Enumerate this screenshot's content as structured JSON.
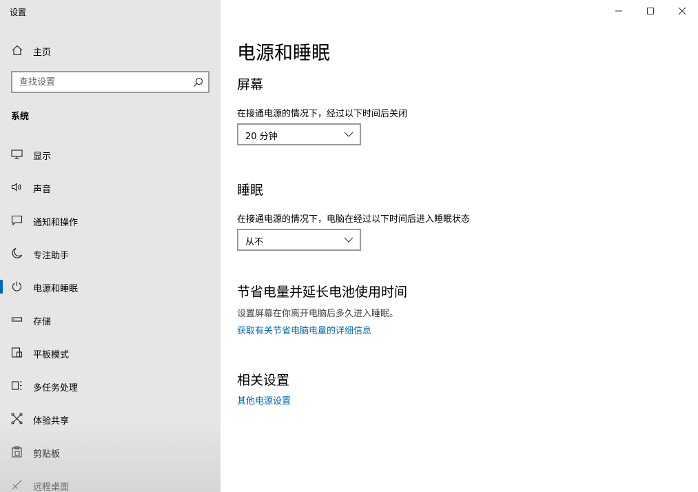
{
  "window": {
    "title": "设置"
  },
  "sidebar": {
    "home_label": "主页",
    "search_placeholder": "查找设置",
    "section_title": "系统",
    "items": [
      {
        "label": "显示",
        "icon": "display-icon",
        "active": false
      },
      {
        "label": "声音",
        "icon": "speaker-icon",
        "active": false
      },
      {
        "label": "通知和操作",
        "icon": "notification-icon",
        "active": false
      },
      {
        "label": "专注助手",
        "icon": "moon-icon",
        "active": false
      },
      {
        "label": "电源和睡眠",
        "icon": "power-icon",
        "active": true
      },
      {
        "label": "存储",
        "icon": "storage-icon",
        "active": false
      },
      {
        "label": "平板模式",
        "icon": "tablet-icon",
        "active": false
      },
      {
        "label": "多任务处理",
        "icon": "multitasking-icon",
        "active": false
      },
      {
        "label": "体验共享",
        "icon": "share-icon",
        "active": false
      },
      {
        "label": "剪贴板",
        "icon": "clipboard-icon",
        "active": false
      },
      {
        "label": "远程桌面",
        "icon": "remote-desktop-icon",
        "active": false
      }
    ]
  },
  "main": {
    "page_title": "电源和睡眠",
    "screen": {
      "heading": "屏幕",
      "description": "在接通电源的情况下，经过以下时间后关闭",
      "selected": "20 分钟"
    },
    "sleep": {
      "heading": "睡眠",
      "description": "在接通电源的情况下，电脑在经过以下时间后进入睡眠状态",
      "selected": "从不"
    },
    "battery": {
      "heading": "节省电量并延长电池使用时间",
      "description": "设置屏幕在你离开电脑后多久进入睡眠。",
      "link": "获取有关节省电脑电量的详细信息"
    },
    "related": {
      "heading": "相关设置",
      "link": "其他电源设置"
    }
  },
  "colors": {
    "sidebar_bg": "#e6e6e6",
    "accent": "#0067c0",
    "link": "#0067b8"
  }
}
